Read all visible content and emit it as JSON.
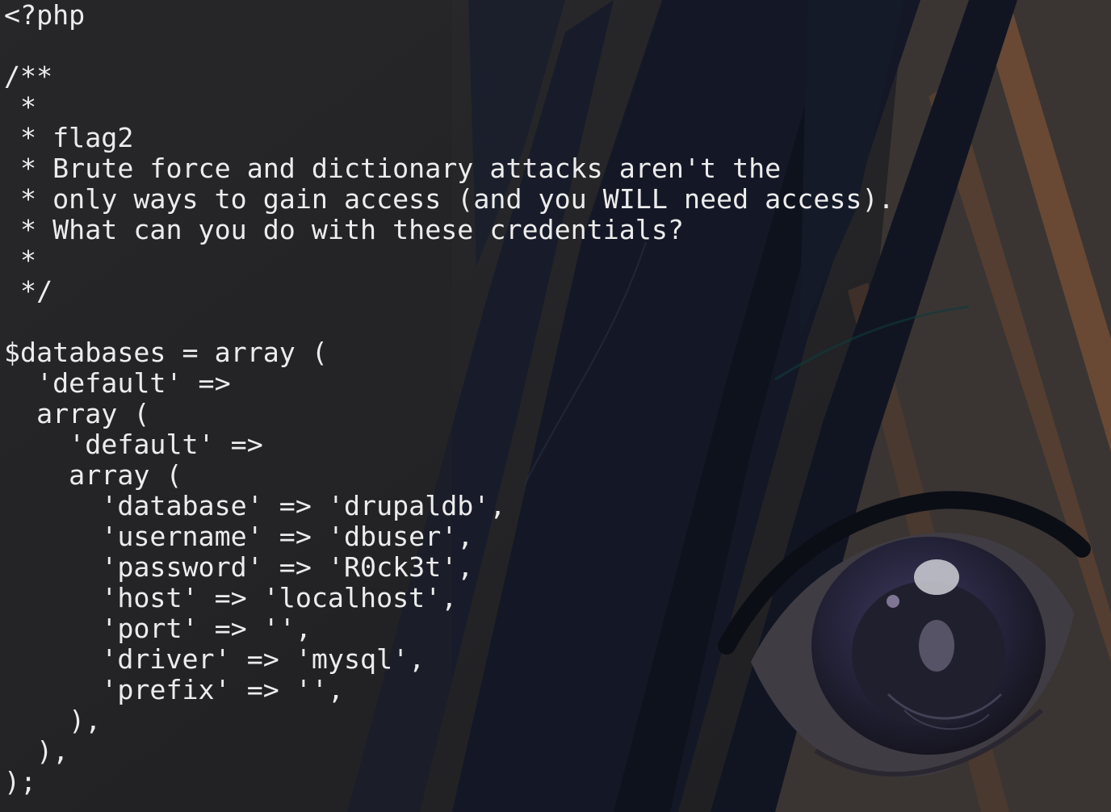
{
  "terminal": {
    "wallpaper": "anime-character-eye-wallpaper",
    "colors": {
      "background": "#232325",
      "text": "#ececec",
      "hair": "#121623",
      "iris": "#2b2b4a",
      "skin_accent": "#b77a55"
    },
    "lines": [
      "<?php",
      "",
      "/**",
      " *",
      " * flag2",
      " * Brute force and dictionary attacks aren't the",
      " * only ways to gain access (and you WILL need access).",
      " * What can you do with these credentials?",
      " *",
      " */",
      "",
      "$databases = array (",
      "  'default' =>",
      "  array (",
      "    'default' =>",
      "    array (",
      "      'database' => 'drupaldb',",
      "      'username' => 'dbuser',",
      "      'password' => 'R0ck3t',",
      "      'host' => 'localhost',",
      "      'port' => '',",
      "      'driver' => 'mysql',",
      "      'prefix' => '',",
      "    ),",
      "  ),",
      ");"
    ]
  }
}
